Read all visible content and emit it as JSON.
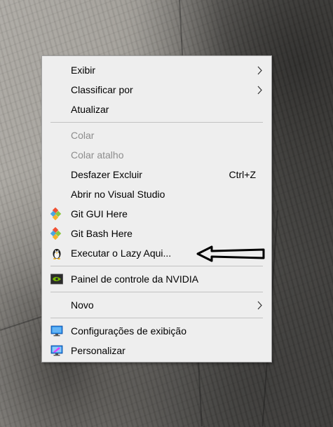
{
  "context_menu": {
    "items": [
      {
        "label": "Exibir",
        "has_submenu": true,
        "enabled": true
      },
      {
        "label": "Classificar por",
        "has_submenu": true,
        "enabled": true
      },
      {
        "label": "Atualizar",
        "enabled": true
      },
      {
        "label": "Colar",
        "enabled": false
      },
      {
        "label": "Colar atalho",
        "enabled": false
      },
      {
        "label": "Desfazer Excluir",
        "shortcut": "Ctrl+Z",
        "enabled": true
      },
      {
        "label": "Abrir no Visual Studio",
        "enabled": true
      },
      {
        "label": "Git GUI Here",
        "icon": "git-icon",
        "enabled": true
      },
      {
        "label": "Git Bash Here",
        "icon": "git-icon",
        "enabled": true
      },
      {
        "label": "Executar o Lazy Aqui...",
        "icon": "penguin-icon",
        "enabled": true
      },
      {
        "label": "Painel de controle da NVIDIA",
        "icon": "nvidia-icon",
        "enabled": true
      },
      {
        "label": "Novo",
        "has_submenu": true,
        "enabled": true
      },
      {
        "label": "Configurações de exibição",
        "icon": "display-settings-icon",
        "enabled": true
      },
      {
        "label": "Personalizar",
        "icon": "personalize-icon",
        "enabled": true
      }
    ]
  },
  "colors": {
    "menu_background": "#eeeeee",
    "disabled_text": "#8d8d8d",
    "separator": "#c2c2c2",
    "git_red": "#f05133",
    "nvidia_green": "#76b900"
  }
}
